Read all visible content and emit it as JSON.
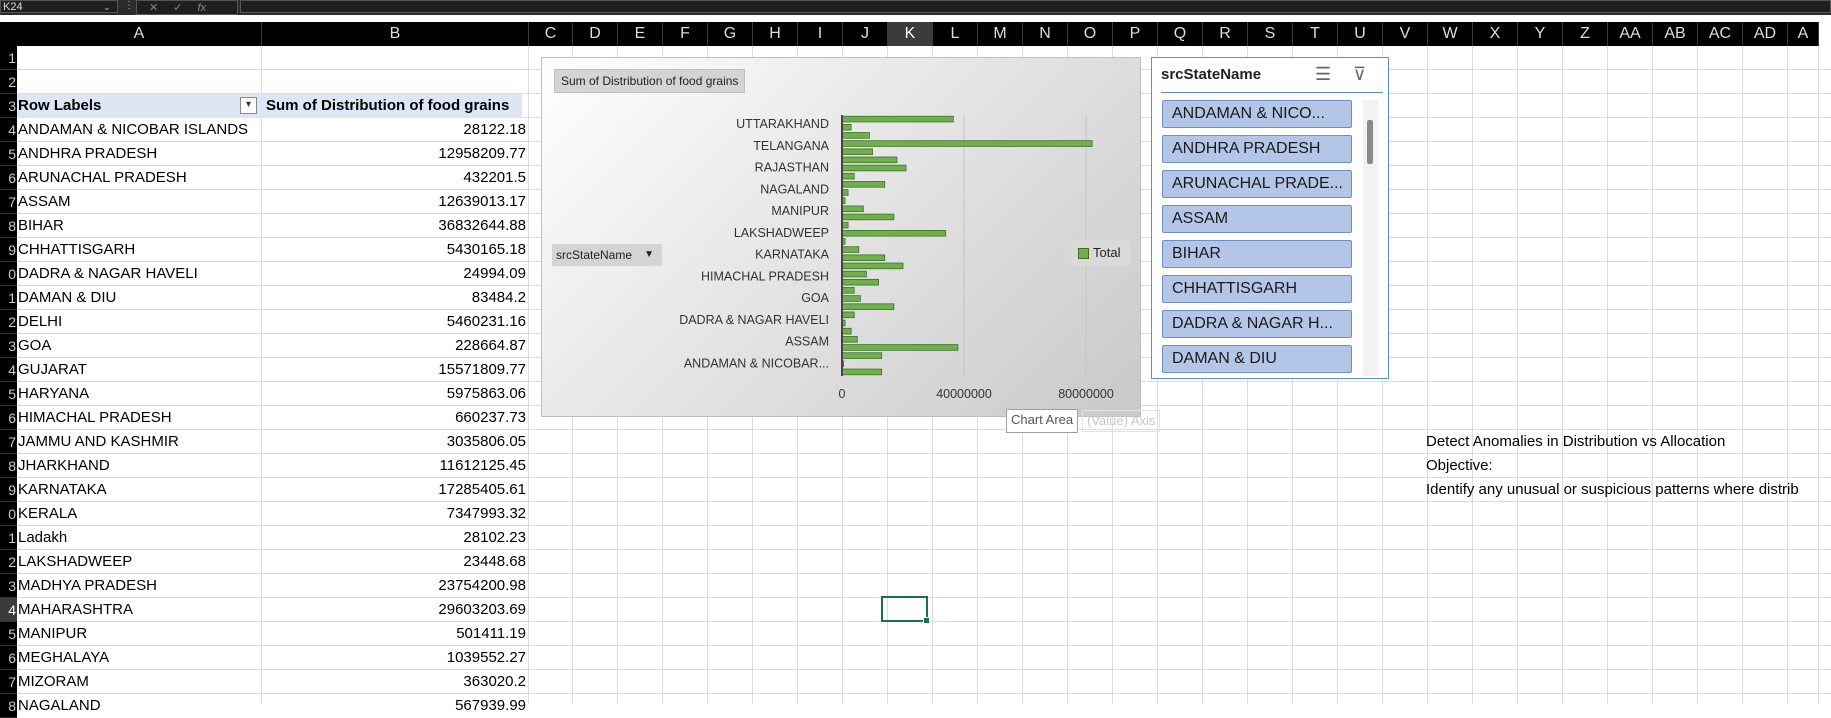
{
  "formula_bar": {
    "name_box": "K24",
    "fx_label": "fx"
  },
  "columns": [
    "A",
    "B",
    "C",
    "D",
    "E",
    "F",
    "G",
    "H",
    "I",
    "J",
    "K",
    "L",
    "M",
    "N",
    "O",
    "P",
    "Q",
    "R",
    "S",
    "T",
    "U",
    "V",
    "W",
    "X",
    "Y",
    "Z",
    "AA",
    "AB",
    "AC",
    "AD",
    "A"
  ],
  "selected_column": "K",
  "row_numbers": [
    "1",
    "2",
    "3",
    "4",
    "5",
    "6",
    "7",
    "8",
    "9",
    "0",
    "1",
    "2",
    "3",
    "4",
    "5",
    "6",
    "7",
    "8",
    "9",
    "0",
    "1",
    "2",
    "3",
    "4",
    "5",
    "6",
    "7",
    "8"
  ],
  "selected_row_index": 23,
  "pivot": {
    "header_labels": "Row Labels",
    "header_values": "Sum of Distribution of food grains",
    "rows": [
      {
        "label": "ANDAMAN & NICOBAR ISLANDS",
        "value": "28122.18"
      },
      {
        "label": "ANDHRA PRADESH",
        "value": "12958209.77"
      },
      {
        "label": "ARUNACHAL PRADESH",
        "value": "432201.5"
      },
      {
        "label": "ASSAM",
        "value": "12639013.17"
      },
      {
        "label": "BIHAR",
        "value": "36832644.88"
      },
      {
        "label": "CHHATTISGARH",
        "value": "5430165.18"
      },
      {
        "label": "DADRA & NAGAR HAVELI",
        "value": "24994.09"
      },
      {
        "label": "DAMAN & DIU",
        "value": "83484.2"
      },
      {
        "label": "DELHI",
        "value": "5460231.16"
      },
      {
        "label": "GOA",
        "value": "228664.87"
      },
      {
        "label": "GUJARAT",
        "value": "15571809.77"
      },
      {
        "label": "HARYANA",
        "value": "5975863.06"
      },
      {
        "label": "HIMACHAL PRADESH",
        "value": "660237.73"
      },
      {
        "label": "JAMMU AND KASHMIR",
        "value": "3035806.05"
      },
      {
        "label": "JHARKHAND",
        "value": "11612125.45"
      },
      {
        "label": "KARNATAKA",
        "value": "17285405.61"
      },
      {
        "label": "KERALA",
        "value": "7347993.32"
      },
      {
        "label": "Ladakh",
        "value": "28102.23"
      },
      {
        "label": "LAKSHADWEEP",
        "value": "23448.68"
      },
      {
        "label": "MADHYA PRADESH",
        "value": "23754200.98"
      },
      {
        "label": "MAHARASHTRA",
        "value": "29603203.69"
      },
      {
        "label": "MANIPUR",
        "value": "501411.19"
      },
      {
        "label": "MEGHALAYA",
        "value": "1039552.27"
      },
      {
        "label": "MIZORAM",
        "value": "363020.2"
      },
      {
        "label": "NAGALAND",
        "value": "567939.99"
      }
    ]
  },
  "chart": {
    "title_button": "Sum of Distribution  of food grains",
    "field_button": "srcStateName",
    "legend": "Total",
    "tooltip": "Chart Area",
    "tooltip_ghost": "(Value) Axis"
  },
  "chart_data": {
    "type": "bar",
    "orientation": "horizontal",
    "visible_category_labels": [
      "UTTARAKHAND",
      "TELANGANA",
      "RAJASTHAN",
      "NAGALAND",
      "MANIPUR",
      "LAKSHADWEEP",
      "KARNATAKA",
      "HIMACHAL PRADESH",
      "GOA",
      "DADRA & NAGAR HAVELI",
      "ASSAM",
      "ANDAMAN & NICOBAR..."
    ],
    "values_top_to_bottom": [
      36500000,
      3000000,
      9000000,
      82000000,
      10000000,
      18000000,
      21000000,
      4000000,
      14000000,
      2000000,
      1000000,
      7000000,
      17000000,
      2000000,
      34000000,
      1000000,
      5500000,
      14000000,
      20000000,
      8000000,
      12000000,
      4000000,
      6000000,
      17000000,
      4000000,
      1000000,
      3000000,
      5000000,
      38000000,
      13000000,
      500000,
      13000000
    ],
    "tick_labels": [
      "0",
      "40000000",
      "80000000"
    ],
    "xlim": [
      0,
      100000000
    ],
    "series": [
      {
        "name": "Total"
      }
    ],
    "colors": {
      "bar": "#6fb04c",
      "bar_edge": "#3e6f26"
    }
  },
  "slicer": {
    "title": "srcStateName",
    "items": [
      "ANDAMAN & NICO...",
      "ANDHRA PRADESH",
      "ARUNACHAL PRADE...",
      "ASSAM",
      "BIHAR",
      "CHHATTISGARH",
      "DADRA & NAGAR H...",
      "DAMAN & DIU"
    ]
  },
  "notes": {
    "line1": "Detect Anomalies in Distribution vs Allocation",
    "line2": "Objective:",
    "line3": "Identify any unusual or suspicious patterns where distrib"
  }
}
